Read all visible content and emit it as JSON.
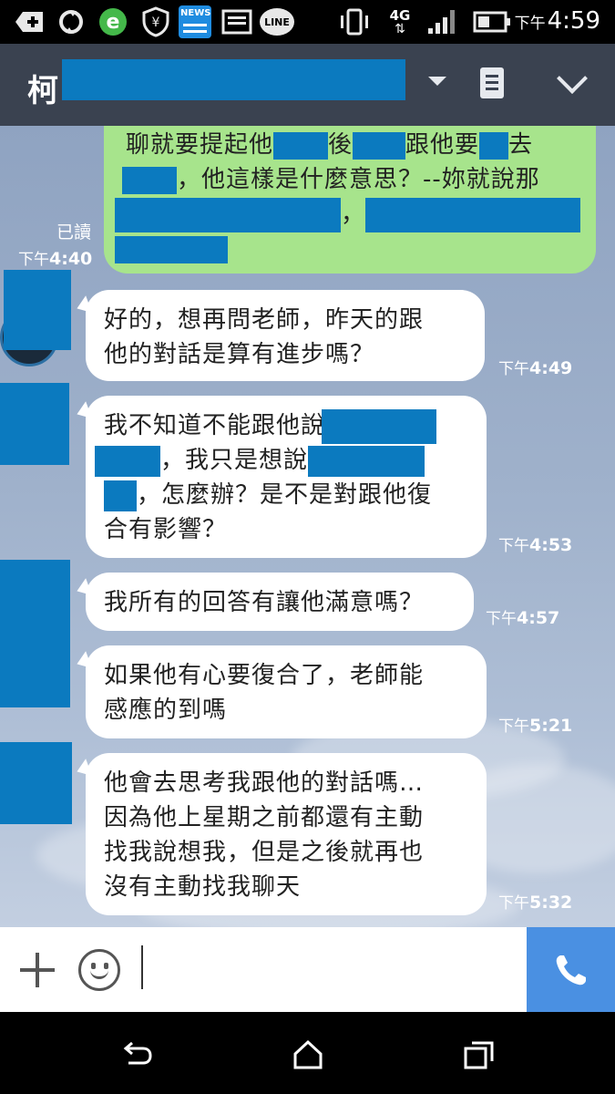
{
  "status_bar": {
    "time_prefix": "下午",
    "time": "4:59",
    "network": "4G",
    "icons": [
      "add-icon",
      "sync-icon",
      "browser-e-icon",
      "shield-icon",
      "news-icon",
      "image-icon",
      "line-icon",
      "vibrate-icon",
      "signal-icon",
      "battery-icon"
    ],
    "news_label": "NEWS",
    "line_label": "LINE"
  },
  "header": {
    "contact_name_visible": "柯",
    "icons": [
      "dropdown-icon",
      "notes-icon",
      "collapse-chevron-icon"
    ]
  },
  "messages": [
    {
      "direction": "outgoing",
      "lines": [
        {
          "before": "聊就要提起他",
          "mid1": "後",
          "mid2": "跟他要",
          "after": "去"
        },
        {
          "text": "，他這樣是什麼意思？--妳就說那"
        },
        {
          "text": "，"
        }
      ],
      "read_label": "已讀",
      "time_prefix": "下午",
      "time": "4:40"
    },
    {
      "direction": "incoming",
      "lines": [
        "好的，想再問老師，昨天的跟",
        "他的對話是算有進步嗎？"
      ],
      "time_prefix": "下午",
      "time": "4:49"
    },
    {
      "direction": "incoming",
      "lines": [
        "我不知道不能跟他說",
        "，我只是想說",
        "，怎麼辦？是不是對跟他復",
        "合有影響？"
      ],
      "time_prefix": "下午",
      "time": "4:53"
    },
    {
      "direction": "incoming",
      "lines": [
        "我所有的回答有讓他滿意嗎？"
      ],
      "time_prefix": "下午",
      "time": "4:57"
    },
    {
      "direction": "incoming",
      "lines": [
        "如果他有心要復合了，老師能",
        "感應的到嗎"
      ],
      "time_prefix": "下午",
      "time": "5:21"
    },
    {
      "direction": "incoming",
      "lines": [
        "他會去思考我跟他的對話嗎…",
        "因為他上星期之前都還有主動",
        "找我說想我，但是之後就再也",
        "沒有主動找我聊天"
      ],
      "time_prefix": "下午",
      "time": "5:32"
    }
  ],
  "input_bar": {
    "icons": [
      "plus-icon",
      "emoji-icon",
      "call-icon"
    ],
    "placeholder": ""
  },
  "nav_bar": {
    "icons": [
      "back-icon",
      "home-icon",
      "recent-apps-icon"
    ]
  },
  "colors": {
    "header_bg": "#3a4250",
    "outgoing_bubble": "#a7e48c",
    "incoming_bubble": "#ffffff",
    "redaction": "#0b7abf",
    "call_button": "#4a90e2"
  }
}
